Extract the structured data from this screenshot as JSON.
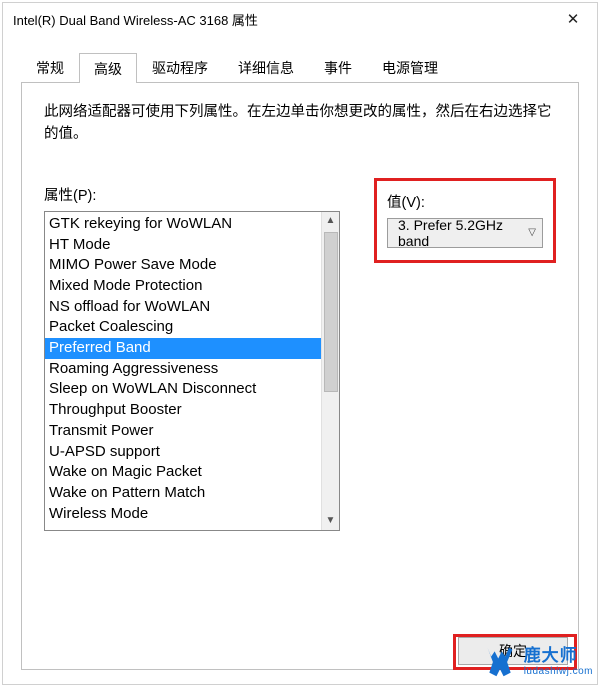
{
  "window": {
    "title": "Intel(R) Dual Band Wireless-AC 3168 属性",
    "close_glyph": "✕"
  },
  "tabs": [
    {
      "label": "常规",
      "active": false
    },
    {
      "label": "高级",
      "active": true
    },
    {
      "label": "驱动程序",
      "active": false
    },
    {
      "label": "详细信息",
      "active": false
    },
    {
      "label": "事件",
      "active": false
    },
    {
      "label": "电源管理",
      "active": false
    }
  ],
  "advanced": {
    "description": "此网络适配器可使用下列属性。在左边单击你想更改的属性，然后在右边选择它的值。",
    "property_label": "属性(P):",
    "value_label": "值(V):",
    "properties": [
      "GTK rekeying for WoWLAN",
      "HT Mode",
      "MIMO Power Save Mode",
      "Mixed Mode Protection",
      "NS offload for WoWLAN",
      "Packet Coalescing",
      "Preferred Band",
      "Roaming Aggressiveness",
      "Sleep on WoWLAN Disconnect",
      "Throughput Booster",
      "Transmit Power",
      "U-APSD support",
      "Wake on Magic Packet",
      "Wake on Pattern Match",
      "Wireless Mode"
    ],
    "selected_property_index": 6,
    "value_selected": "3. Prefer 5.2GHz band"
  },
  "buttons": {
    "ok": "确定"
  },
  "watermark": {
    "name": "鹿大师",
    "url": "ludashiwj.com"
  }
}
